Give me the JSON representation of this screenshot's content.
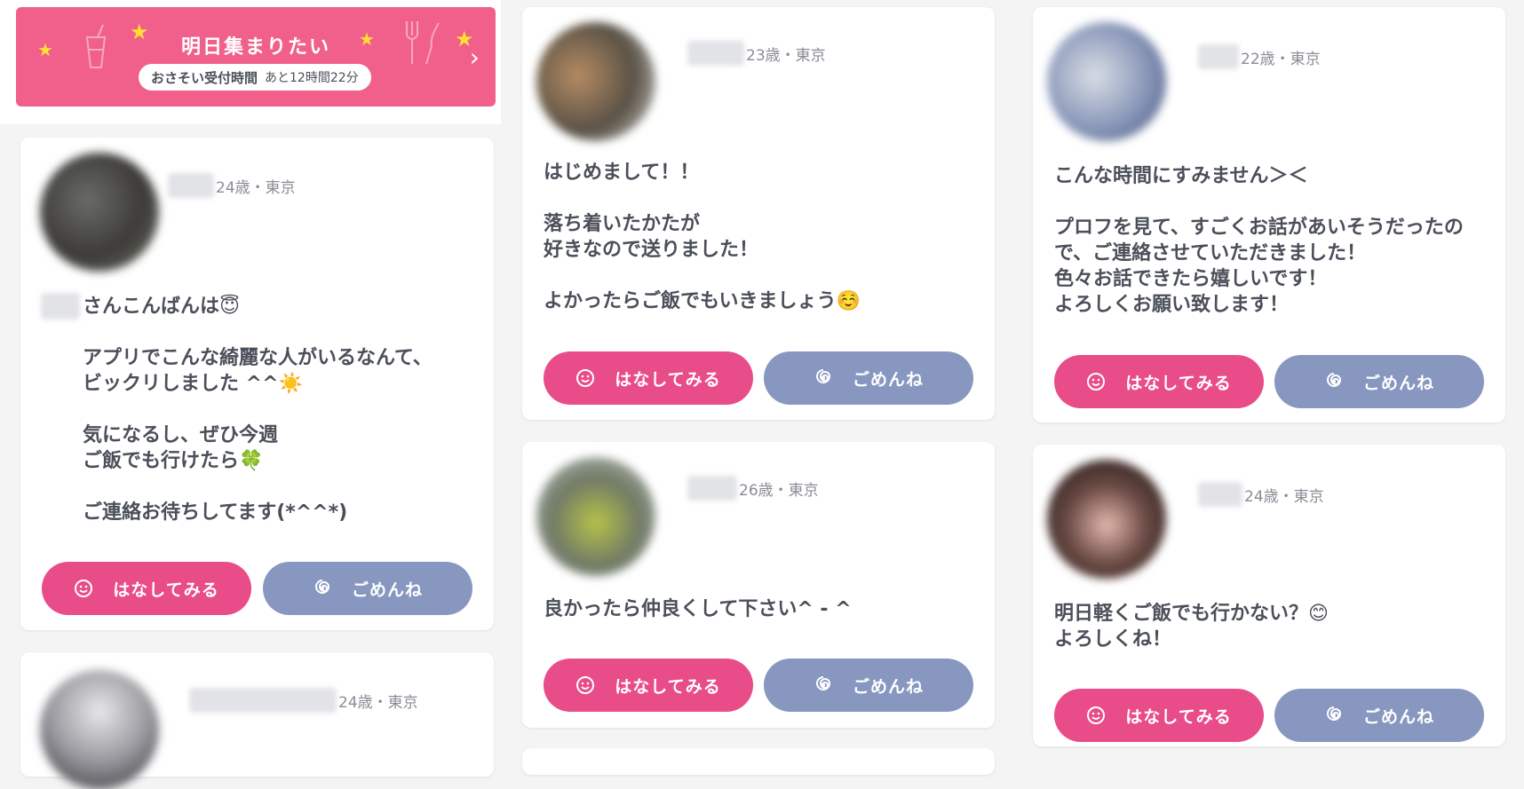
{
  "banner": {
    "title": "明日集まりたい",
    "pill_label": "おさそい受付時間",
    "pill_time": "あと12時間22分"
  },
  "buttons": {
    "talk": "はなしてみる",
    "sorry": "ごめんね"
  },
  "colors": {
    "banner": "#f0608b",
    "talk": "#e84c89",
    "sorry": "#8797c0",
    "star": "#ffe033"
  },
  "cards": [
    {
      "meta": "24歳・東京",
      "message": "さんこんばんは😇\n\nアプリでこんな綺麗な人がいるなんて、\nビックリしました ^^☀️\n\n気になるし、ぜひ今週\nご飯でも行けたら🍀\n\nご連絡お待ちしてます(*^^*)"
    },
    {
      "meta": "24歳・東京"
    },
    {
      "meta": "23歳・東京",
      "message": "はじめまして！！\n\n落ち着いたかたが\n好きなので送りました！\n\nよかったらご飯でもいきましょう☺️"
    },
    {
      "meta": "26歳・東京",
      "message": "良かったら仲良くして下さい^ - ^"
    },
    {
      "meta": "22歳・東京",
      "message": "こんな時間にすみません＞＜\n\nプロフを見て、すごくお話があいそうだったの\nで、ご連絡させていただきました！\n色々お話できたら嬉しいです！\nよろしくお願い致します！"
    },
    {
      "meta": "24歳・東京",
      "message": "明日軽くご飯でも行かない？😊\nよろしくね！"
    }
  ]
}
